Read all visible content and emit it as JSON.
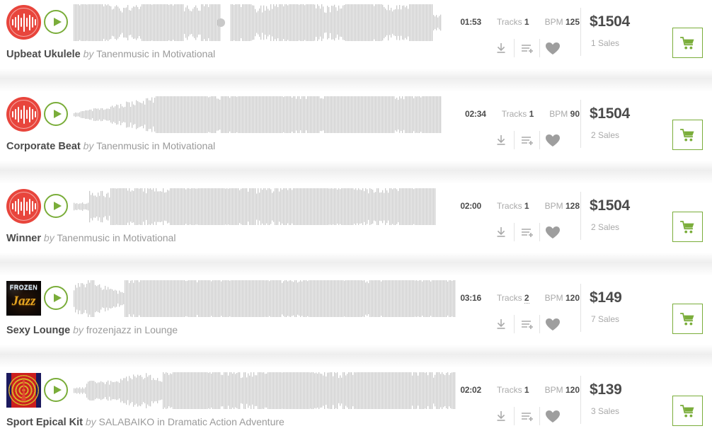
{
  "colors": {
    "accent_green": "#7aad3a",
    "avatar_red": "#e8453c",
    "text_dark": "#4b4b4b",
    "text_muted": "#a9a9a9",
    "waveform_gray": "#c9c9c9",
    "divider": "#e3e3e3"
  },
  "labels": {
    "by": "by",
    "in": "in",
    "tracks": "Tracks",
    "bpm": "BPM"
  },
  "icons": {
    "play": "play-icon",
    "download": "download-icon",
    "add_to_playlist": "add-to-playlist-icon",
    "favorite": "heart-icon",
    "cart": "shopping-cart-icon",
    "waveform_avatar": "audio-waveform-icon"
  },
  "tracks": [
    {
      "title": "Upbeat Ukulele",
      "author": "Tanenmusic",
      "category": "Motivational",
      "duration": "01:53",
      "tracks_count": "1",
      "tracks_tooltip": false,
      "bpm": "125",
      "price": "$1504",
      "sales": "1 Sales",
      "thumb_type": "waveform-red",
      "thumb_text_top": "",
      "thumb_text_bottom": "",
      "waveform_seed": 1,
      "playhead": 0.63
    },
    {
      "title": "Corporate Beat",
      "author": "Tanenmusic",
      "category": "Motivational",
      "duration": "02:34",
      "tracks_count": "1",
      "tracks_tooltip": false,
      "bpm": "90",
      "price": "$1504",
      "sales": "2 Sales",
      "thumb_type": "waveform-red",
      "thumb_text_top": "",
      "thumb_text_bottom": "",
      "waveform_seed": 2,
      "playhead": 0
    },
    {
      "title": "Winner",
      "author": "Tanenmusic",
      "category": "Motivational",
      "duration": "02:00",
      "tracks_count": "1",
      "tracks_tooltip": false,
      "bpm": "128",
      "price": "$1504",
      "sales": "2 Sales",
      "thumb_type": "waveform-red",
      "thumb_text_top": "",
      "thumb_text_bottom": "",
      "waveform_seed": 3,
      "playhead": 0
    },
    {
      "title": "Sexy Lounge",
      "author": "frozenjazz",
      "category": "Lounge",
      "duration": "03:16",
      "tracks_count": "2",
      "tracks_tooltip": true,
      "bpm": "120",
      "price": "$149",
      "sales": "7 Sales",
      "thumb_type": "frozen-jazz",
      "thumb_text_top": "FROZEN",
      "thumb_text_bottom": "Jazz",
      "waveform_seed": 4,
      "playhead": 0
    },
    {
      "title": "Sport Epical Kit",
      "author": "SALABAIKO",
      "category": "Dramatic Action Adventure",
      "duration": "02:02",
      "tracks_count": "1",
      "tracks_tooltip": false,
      "bpm": "120",
      "price": "$139",
      "sales": "3 Sales",
      "thumb_type": "salabaiko",
      "thumb_text_top": "",
      "thumb_text_bottom": "",
      "waveform_seed": 5,
      "playhead": 0
    }
  ]
}
